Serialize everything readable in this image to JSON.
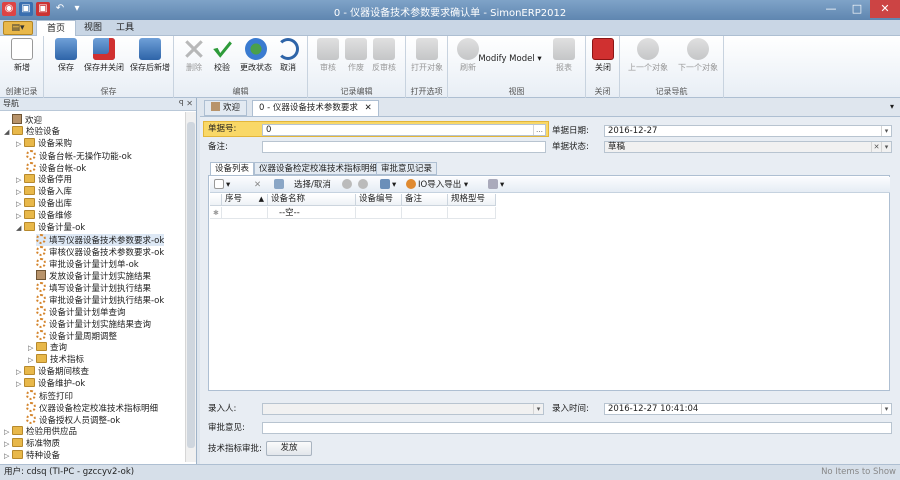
{
  "window": {
    "title": "0 - 仪器设备技术参数要求确认单 - SimonERP2012",
    "controls": [
      "—",
      "□",
      "✕"
    ]
  },
  "menu": {
    "app_button": "▤▾",
    "tabs": [
      "首页",
      "视图",
      "工具"
    ]
  },
  "ribbon": {
    "groups": [
      {
        "name": "创建记录",
        "buttons": [
          "新增"
        ]
      },
      {
        "name": "保存",
        "buttons": [
          "保存",
          "保存并关闭",
          "保存后新增"
        ]
      },
      {
        "name": "编辑",
        "buttons": [
          "删除",
          "校验",
          "更改状态",
          "取消"
        ]
      },
      {
        "name": "记录编辑",
        "buttons": [
          "审核",
          "作废",
          "反审核"
        ]
      },
      {
        "name": "打开选项",
        "buttons": [
          "打开对象"
        ]
      },
      {
        "name": "视图",
        "buttons": [
          "刷新",
          "Modify Model",
          "报表"
        ]
      },
      {
        "name": "关闭",
        "buttons": [
          "关闭"
        ]
      },
      {
        "name": "记录导航",
        "buttons": [
          "上一个对象",
          "下一个对象"
        ]
      }
    ]
  },
  "nav": {
    "title": "导航",
    "pin_icons": "ꟼ ✕",
    "items": [
      "欢迎",
      "检验设备",
      "设备采购",
      "设备台帐-无操作功能-ok",
      "设备台帐-ok",
      "设备停用",
      "设备入库",
      "设备出库",
      "设备维修",
      "设备计量-ok",
      "填写仪器设备技术参数要求-ok",
      "审核仪器设备技术参数要求-ok",
      "审批设备计量计划单-ok",
      "发放设备计量计划实施结果",
      "填写设备计量计划执行结果",
      "审批设备计量计划执行结果-ok",
      "设备计量计划单查询",
      "设备计量计划实施结果查询",
      "设备计量周期调整",
      "查询",
      "技术指标",
      "设备期间核查",
      "设备维护-ok",
      "标签打印",
      "仪器设备检定校准技术指标明细",
      "设备授权人员调整-ok",
      "检验用供应品",
      "标准物质",
      "特种设备"
    ]
  },
  "doc_tabs": [
    "欢迎",
    "0 - 仪器设备技术参数要求"
  ],
  "form": {
    "doc_no_label": "单据号:",
    "doc_no_value": "0",
    "doc_no_button": "…",
    "remark_label": "备注:",
    "remark_value": "",
    "doc_date_label": "单据日期:",
    "doc_date_value": "2016-12-27",
    "doc_status_label": "单据状态:",
    "doc_status_value": "草稿",
    "subtabs": [
      "设备列表",
      "仪器设备检定校准技术指标明细",
      "审批意见记录"
    ],
    "toolbar": {
      "new_icon": "□▾",
      "delete_icon": "✕",
      "select_cancel": "选择/取消",
      "io_export": "IO导入导出",
      "more_icon": "▾"
    },
    "grid": {
      "columns": [
        "序号",
        "设备名称",
        "设备编号",
        "备注",
        "规格型号"
      ],
      "empty_text": "--空--"
    },
    "entry_user_label": "录入人:",
    "entry_user_value": "",
    "entry_time_label": "录入时间:",
    "entry_time_value": "2016-12-27 10:41:04",
    "approval_label": "审批意见:",
    "approval_value": "",
    "tech_approve_label": "技术指标审批:",
    "issue_button": "发放"
  },
  "status": {
    "user_text": "用户: cdsq   (TI-PC - gzccyv2-ok)",
    "right_text": "No Items to Show"
  }
}
